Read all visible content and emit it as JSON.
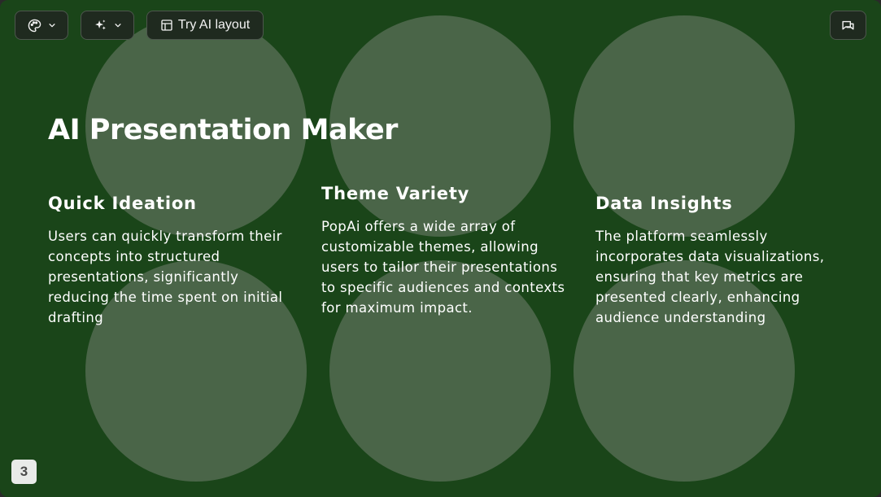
{
  "toolbar": {
    "theme_icon": "palette-icon",
    "ai_icon": "sparkles-icon",
    "layout_icon": "layout-icon",
    "layout_label": "Try AI layout",
    "comment_icon": "comment-icon"
  },
  "slide": {
    "title": "AI Presentation Maker",
    "columns": [
      {
        "heading": "Quick Ideation",
        "body": "Users can quickly transform their concepts into structured presentations, significantly reducing the time spent on initial drafting"
      },
      {
        "heading": "Theme Variety",
        "body": "PopAi offers a wide array of customizable themes, allowing users to tailor their presentations to specific audiences and contexts for maximum impact."
      },
      {
        "heading": "Data Insights",
        "body": "The platform seamlessly incorporates data visualizations, ensuring that key metrics are presented clearly, enhancing audience understanding"
      }
    ],
    "page_number": "3"
  },
  "colors": {
    "background": "#1a4519",
    "circle": "#4a6548",
    "text": "#ffffff"
  }
}
